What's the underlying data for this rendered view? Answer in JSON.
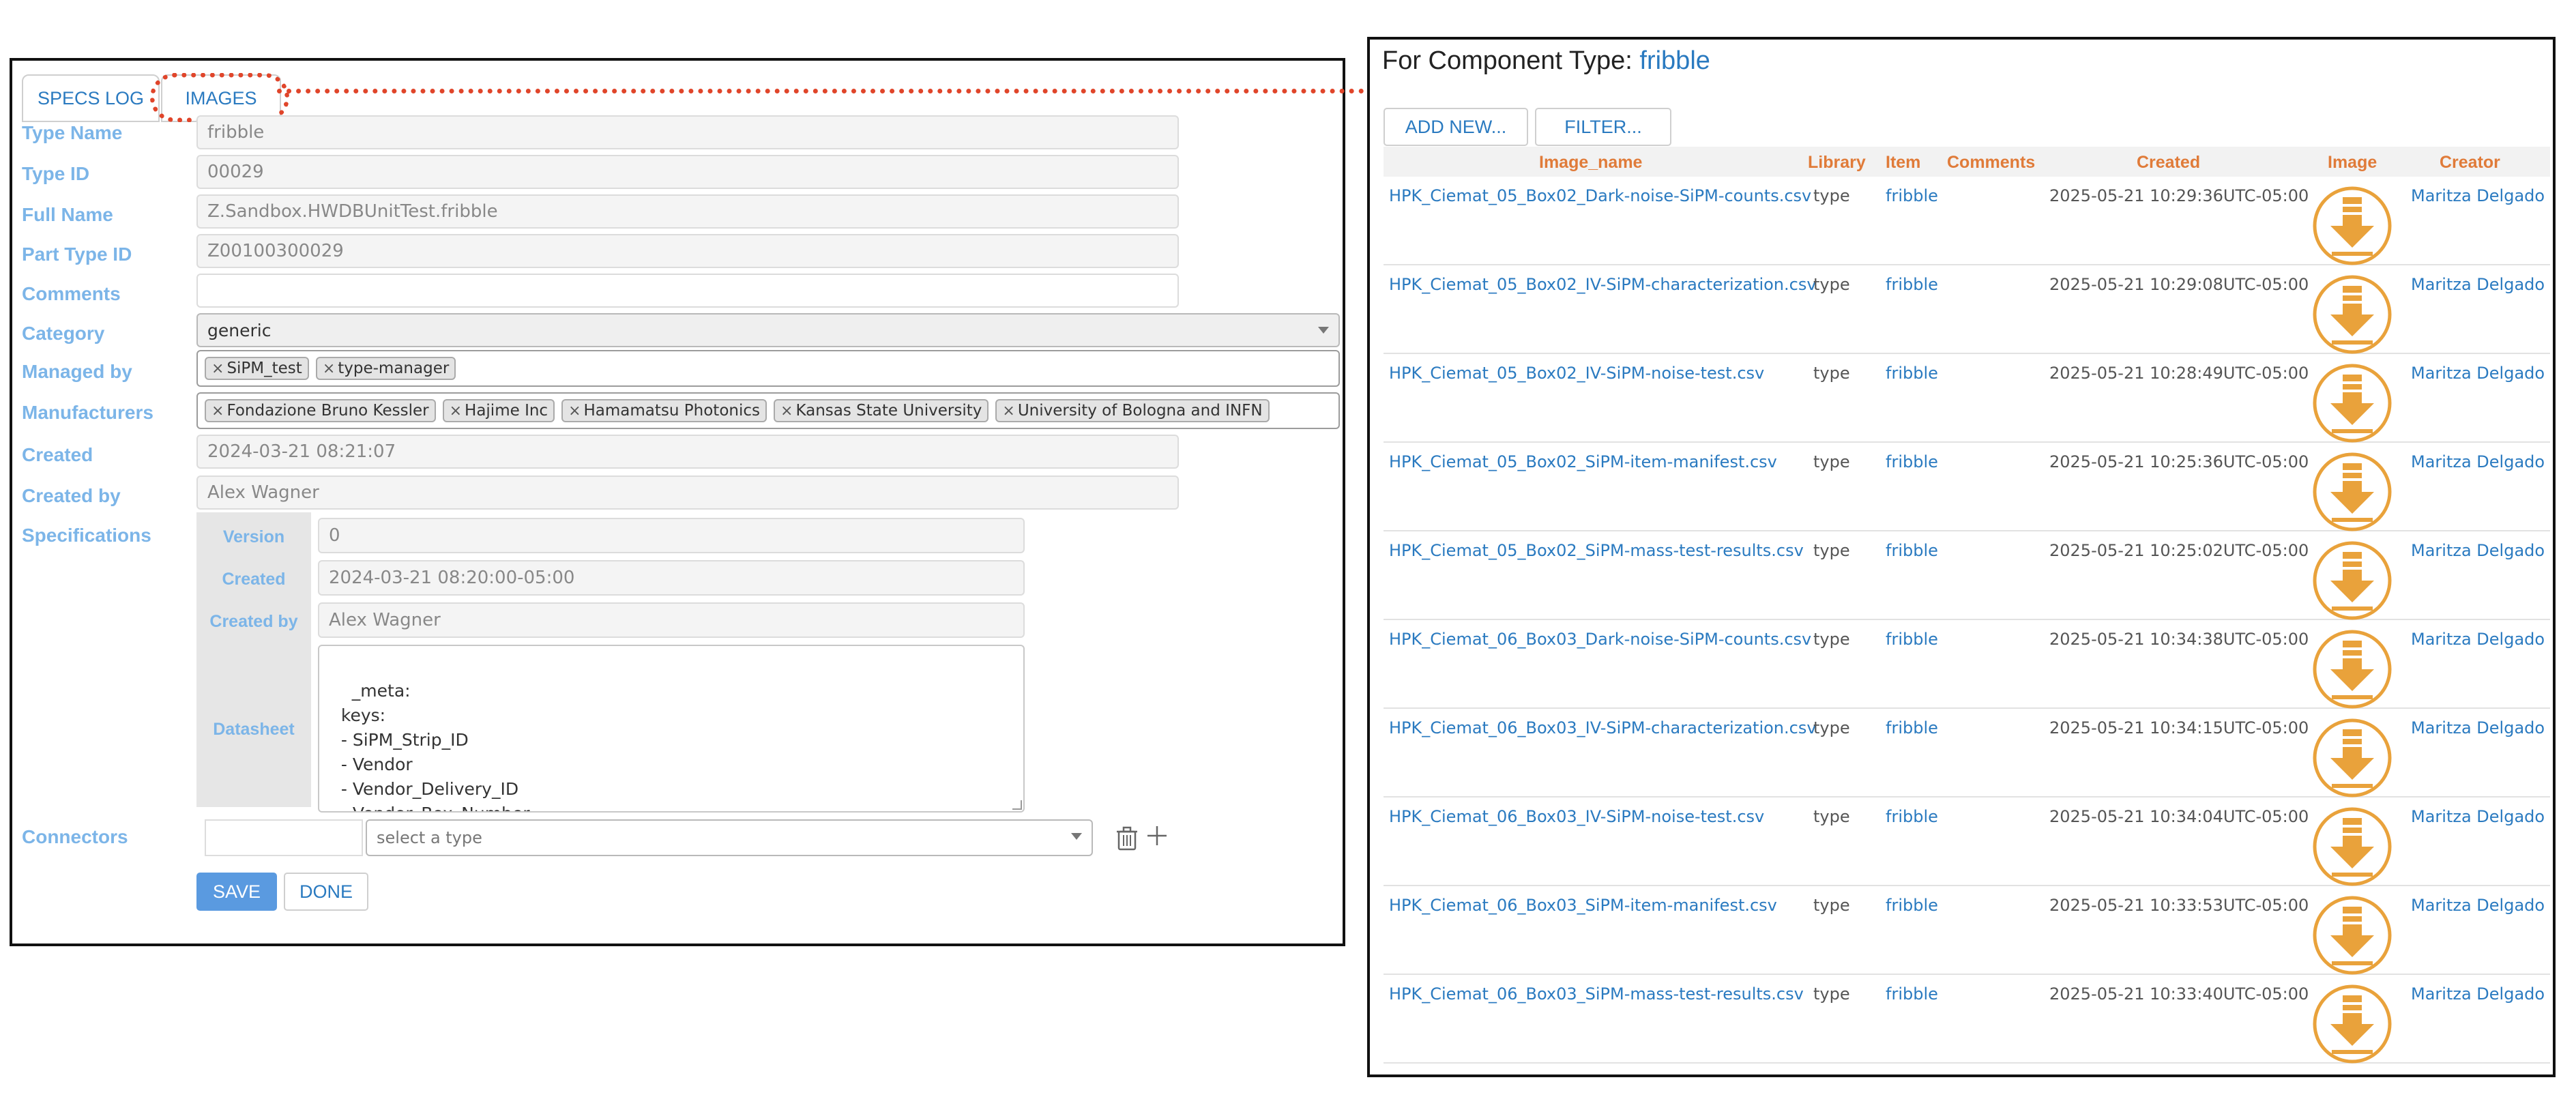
{
  "tabs": {
    "specs_log": "SPECS LOG",
    "images": "IMAGES"
  },
  "form": {
    "type_name": {
      "label": "Type Name",
      "value": "fribble"
    },
    "type_id": {
      "label": "Type ID",
      "value": "00029"
    },
    "full_name": {
      "label": "Full Name",
      "value": "Z.Sandbox.HWDBUnitTest.fribble"
    },
    "part_type_id": {
      "label": "Part Type ID",
      "value": "Z00100300029"
    },
    "comments": {
      "label": "Comments",
      "value": ""
    },
    "category": {
      "label": "Category",
      "value": "generic"
    },
    "managed_by": {
      "label": "Managed by",
      "tags": [
        "SiPM_test",
        "type-manager"
      ]
    },
    "manufacturers": {
      "label": "Manufacturers",
      "tags": [
        "Fondazione Bruno Kessler",
        "Hajime Inc",
        "Hamamatsu Photonics",
        "Kansas State University",
        "University of Bologna and INFN"
      ]
    },
    "created": {
      "label": "Created",
      "value": "2024-03-21 08:21:07"
    },
    "created_by": {
      "label": "Created by",
      "value": "Alex Wagner"
    },
    "specifications": {
      "label": "Specifications",
      "version": {
        "label": "Version",
        "value": "0"
      },
      "created": {
        "label": "Created",
        "value": "2024-03-21 08:20:00-05:00"
      },
      "created_by": {
        "label": "Created by",
        "value": "Alex Wagner"
      },
      "datasheet": {
        "label": "Datasheet",
        "value": "_meta:\n  keys:\n  - SiPM_Strip_ID\n  - Vendor\n  - Vendor_Delivery_ID\n  - Vendor_Box_Number\n  - Tray_Number"
      }
    },
    "connectors": {
      "label": "Connectors",
      "type_placeholder": "select a type"
    },
    "save_label": "SAVE",
    "done_label": "DONE"
  },
  "images_panel": {
    "title_prefix": "For Component Type:",
    "title_link": "fribble",
    "add_new_label": "ADD NEW...",
    "filter_label": "FILTER...",
    "columns": [
      "Image_name",
      "Library",
      "Item",
      "Comments",
      "Created",
      "Image",
      "Creator"
    ],
    "rows": [
      {
        "name": "HPK_Ciemat_05_Box02_Dark-noise-SiPM-counts.csv",
        "library": "type",
        "item": "fribble",
        "comments": "",
        "created": "2025-05-21 10:29:36UTC-05:00",
        "image": "download-icon",
        "creator": "Maritza Delgado"
      },
      {
        "name": "HPK_Ciemat_05_Box02_IV-SiPM-characterization.csv",
        "library": "type",
        "item": "fribble",
        "comments": "",
        "created": "2025-05-21 10:29:08UTC-05:00",
        "image": "download-icon",
        "creator": "Maritza Delgado"
      },
      {
        "name": "HPK_Ciemat_05_Box02_IV-SiPM-noise-test.csv",
        "library": "type",
        "item": "fribble",
        "comments": "",
        "created": "2025-05-21 10:28:49UTC-05:00",
        "image": "download-icon",
        "creator": "Maritza Delgado"
      },
      {
        "name": "HPK_Ciemat_05_Box02_SiPM-item-manifest.csv",
        "library": "type",
        "item": "fribble",
        "comments": "",
        "created": "2025-05-21 10:25:36UTC-05:00",
        "image": "download-icon",
        "creator": "Maritza Delgado"
      },
      {
        "name": "HPK_Ciemat_05_Box02_SiPM-mass-test-results.csv",
        "library": "type",
        "item": "fribble",
        "comments": "",
        "created": "2025-05-21 10:25:02UTC-05:00",
        "image": "download-icon",
        "creator": "Maritza Delgado"
      },
      {
        "name": "HPK_Ciemat_06_Box03_Dark-noise-SiPM-counts.csv",
        "library": "type",
        "item": "fribble",
        "comments": "",
        "created": "2025-05-21 10:34:38UTC-05:00",
        "image": "download-icon",
        "creator": "Maritza Delgado"
      },
      {
        "name": "HPK_Ciemat_06_Box03_IV-SiPM-characterization.csv",
        "library": "type",
        "item": "fribble",
        "comments": "",
        "created": "2025-05-21 10:34:15UTC-05:00",
        "image": "download-icon",
        "creator": "Maritza Delgado"
      },
      {
        "name": "HPK_Ciemat_06_Box03_IV-SiPM-noise-test.csv",
        "library": "type",
        "item": "fribble",
        "comments": "",
        "created": "2025-05-21 10:34:04UTC-05:00",
        "image": "download-icon",
        "creator": "Maritza Delgado"
      },
      {
        "name": "HPK_Ciemat_06_Box03_SiPM-item-manifest.csv",
        "library": "type",
        "item": "fribble",
        "comments": "",
        "created": "2025-05-21 10:33:53UTC-05:00",
        "image": "download-icon",
        "creator": "Maritza Delgado"
      },
      {
        "name": "HPK_Ciemat_06_Box03_SiPM-mass-test-results.csv",
        "library": "type",
        "item": "fribble",
        "comments": "",
        "created": "2025-05-21 10:33:40UTC-05:00",
        "image": "download-icon",
        "creator": "Maritza Delgado"
      }
    ]
  },
  "colors": {
    "label_blue": "#7cb5e8",
    "link_blue": "#2a7ac0",
    "header_orange": "#e07b39",
    "annotation_red": "#e0452a",
    "save_blue": "#5a9ae0"
  }
}
